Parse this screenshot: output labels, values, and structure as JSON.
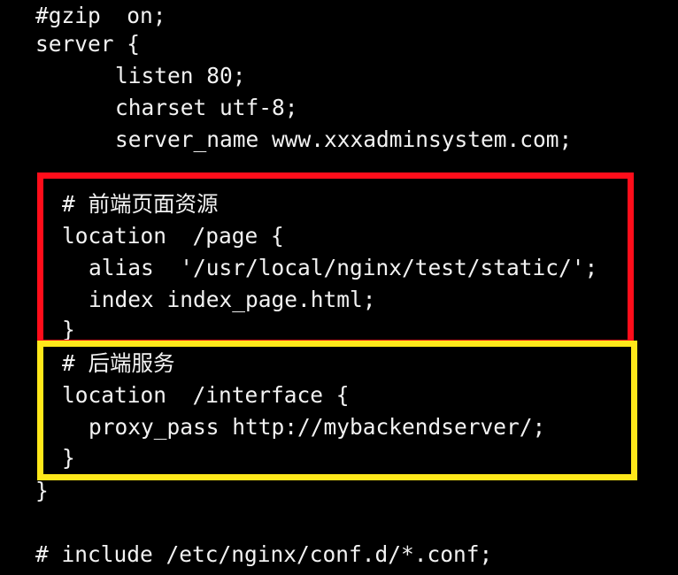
{
  "editor": {
    "background": "#000000",
    "text_color": "#f2f2f2",
    "lines": [
      "#gzip  on;",
      "server {",
      "listen 80;",
      "charset utf-8;",
      "server_name www.xxxadminsystem.com;",
      "# 前端页面资源",
      "location  /page {",
      "alias  '/usr/local/nginx/test/static/';",
      "index index_page.html;",
      "}",
      "# 后端服务",
      "location  /interface {",
      "proxy_pass http://mybackendserver/;",
      "}",
      "}",
      "# include /etc/nginx/conf.d/*.conf;"
    ]
  },
  "highlights": {
    "frontend_box_color": "#ff0d1a",
    "backend_box_color": "#ffe81a"
  }
}
